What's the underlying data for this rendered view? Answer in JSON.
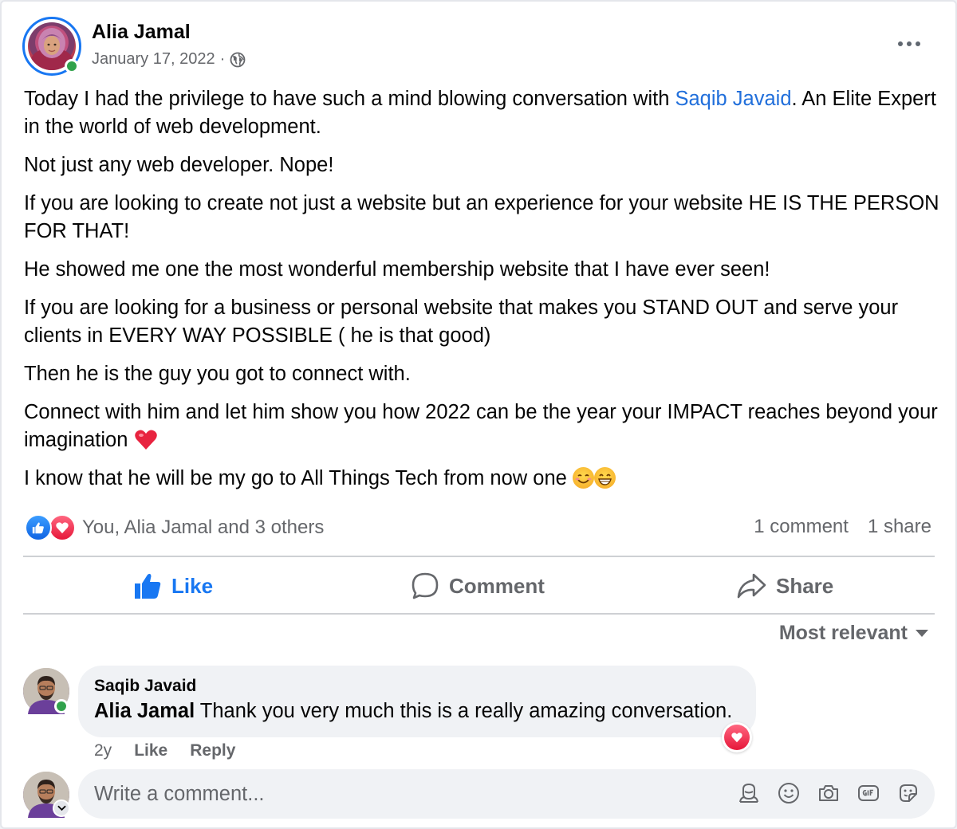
{
  "post": {
    "author": "Alia Jamal",
    "date": "January 17, 2022",
    "separator": "·",
    "privacy_icon": "globe-icon",
    "paragraphs": {
      "p1_before": "Today I had the privilege to have such a mind blowing conversation with ",
      "p1_mention": "Saqib Javaid",
      "p1_after": ". An Elite Expert in the world of web development.",
      "p2": "Not just any web developer. Nope!",
      "p3": "If you are looking to create not just a website but an experience for your website HE IS THE PERSON FOR THAT!",
      "p4": "He showed me one the most wonderful membership website that I have ever seen!",
      "p5": "If you are looking for a business or personal website that makes you STAND OUT and serve your clients in EVERY WAY POSSIBLE ( he is that good)",
      "p6": "Then he is the guy you got to connect with.",
      "p7": "Connect with him and let him show you how 2022 can be the year your IMPACT reaches beyond your imagination",
      "p8": "I know that he will be my go to All Things Tech from now one"
    }
  },
  "reactions": {
    "text": "You, Alia Jamal and 3 others",
    "comments": "1 comment",
    "shares": "1 share"
  },
  "actions": {
    "like": "Like",
    "comment": "Comment",
    "share": "Share"
  },
  "sort": {
    "label": "Most relevant"
  },
  "comment": {
    "author": "Saqib Javaid",
    "mention": "Alia Jamal",
    "text": " Thank you very much this is a really amazing conversation.",
    "age": "2y",
    "like": "Like",
    "reply": "Reply"
  },
  "composer": {
    "placeholder": "Write a comment..."
  },
  "colors": {
    "accent": "#1877f2",
    "mention": "#216fdb",
    "love": "#e61739",
    "online": "#31a24c",
    "secondary_text": "#65676b"
  }
}
